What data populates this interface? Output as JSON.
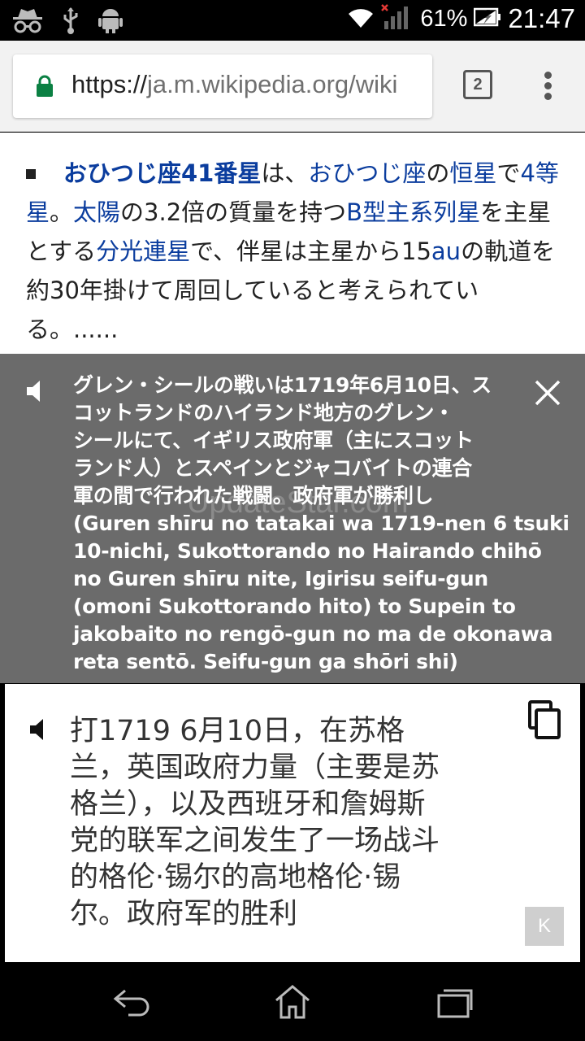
{
  "status_bar": {
    "battery_percent": "61%",
    "time": "21:47",
    "icons": [
      "incognito-icon",
      "usb-icon",
      "android-icon",
      "wifi-icon",
      "signal-icon",
      "battery-charging-icon"
    ]
  },
  "browser": {
    "url_scheme": "https://",
    "url_rest": "ja.m.wikipedia.org/wiki",
    "tab_count": "2"
  },
  "article": {
    "segments": [
      {
        "text": "おひつじ座41番星",
        "type": "link-bold"
      },
      {
        "text": "は、",
        "type": "text"
      },
      {
        "text": "おひつじ座",
        "type": "link"
      },
      {
        "text": "の",
        "type": "text"
      },
      {
        "text": "恒星",
        "type": "link"
      },
      {
        "text": "で",
        "type": "text"
      },
      {
        "text": "4等星",
        "type": "link"
      },
      {
        "text": "。",
        "type": "text"
      },
      {
        "text": "太陽",
        "type": "link"
      },
      {
        "text": "の3.2倍の質量を持つ",
        "type": "text"
      },
      {
        "text": "B型主系列星",
        "type": "link"
      },
      {
        "text": "を主星とする",
        "type": "text"
      },
      {
        "text": "分光連星",
        "type": "link"
      },
      {
        "text": "で、伴星は主星から15",
        "type": "text"
      },
      {
        "text": "au",
        "type": "link"
      },
      {
        "text": "の軌道を約30年掛けて周回していると考えられている。......",
        "type": "text"
      }
    ]
  },
  "translation": {
    "source_lines": [
      "グレン・シールの戦いは1719年6月10日、ス",
      "コットランドのハイランド地方のグレン・",
      "シールにて、イギリス政府軍（主にスコット",
      "ランド人）とスペインとジャコバイトの連合",
      "軍の間で行われた戦闘。政府軍が勝利し",
      "(Guren shīru no tatakai wa 1719-nen 6 tsuki",
      "10-nichi, Sukottorando no Hairando chihō",
      "no Guren shīru nite, Igirisu seifu-gun",
      "(omoni Sukottorando hito) to Supein to",
      "jakobaito no rengō-gun no ma de okonawa",
      "reta sentō. Seifu-gun ga shōri shi)"
    ],
    "target_lines": [
      "打1719 6月10日，在苏格",
      "兰，英国政府力量（主要是苏",
      "格兰），以及西班牙和詹姆斯",
      "党的联军之间发生了一场战斗",
      "的格伦·锡尔的高地格伦·锡",
      "尔。政府军的胜利"
    ],
    "k_label": "K",
    "watermark": "UpdateStar.com"
  },
  "colors": {
    "link": "#0b3d9e",
    "panel_gray": "#6b6b6b",
    "lock_green": "#0b8043"
  }
}
